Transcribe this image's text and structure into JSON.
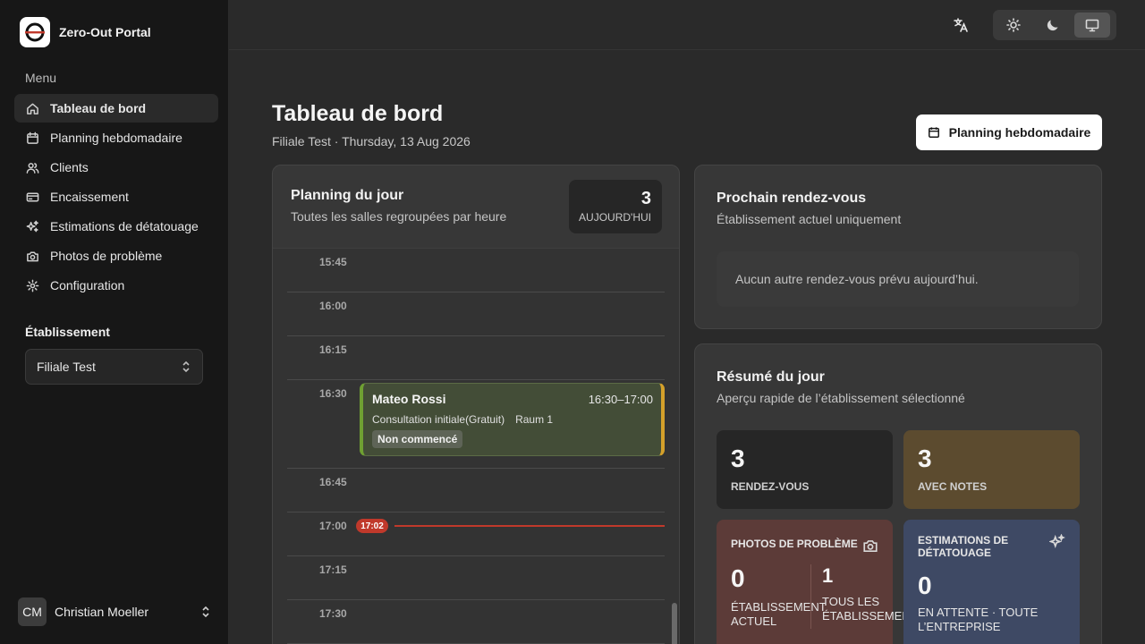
{
  "brand": {
    "title": "Zero-Out Portal"
  },
  "sidebar": {
    "menu_label": "Menu",
    "items": [
      {
        "label": "Tableau de bord",
        "icon": "home-icon",
        "active": true
      },
      {
        "label": "Planning hebdomadaire",
        "icon": "calendar-icon"
      },
      {
        "label": "Clients",
        "icon": "users-icon"
      },
      {
        "label": "Encaissement",
        "icon": "credit-card-icon"
      },
      {
        "label": "Estimations de détatouage",
        "icon": "sparkles-icon"
      },
      {
        "label": "Photos de problème",
        "icon": "camera-icon"
      },
      {
        "label": "Configuration",
        "icon": "gear-icon"
      }
    ],
    "establishment_label": "Établissement",
    "establishment_value": "Filiale Test"
  },
  "user": {
    "initials": "CM",
    "name": "Christian Moeller"
  },
  "topbar": {
    "translate_icon": "translate-icon",
    "themes": [
      "sun-icon",
      "moon-icon",
      "monitor-icon"
    ],
    "active_theme": "monitor-icon"
  },
  "header": {
    "title": "Tableau de bord",
    "subtitle": "Filiale Test · Thursday, 13 Aug 2026",
    "week_button": "Planning hebdomadaire"
  },
  "planning": {
    "title": "Planning du jour",
    "subtitle": "Toutes les salles regroupées par heure",
    "today_count": "3",
    "today_label": "Aujourd'hui",
    "slots": [
      "15:45",
      "16:00",
      "16:15",
      "16:30",
      "16:45",
      "17:00",
      "17:15",
      "17:30"
    ],
    "appointment": {
      "name": "Mateo Rossi",
      "time": "16:30–17:00",
      "type": "Consultation initiale(Gratuit)",
      "room": "Raum 1",
      "status": "Non commencé"
    },
    "now": "17:02"
  },
  "next": {
    "title": "Prochain rendez-vous",
    "subtitle": "Établissement actuel uniquement",
    "empty": "Aucun autre rendez-vous prévu aujourd’hui."
  },
  "summary": {
    "title": "Résumé du jour",
    "subtitle": "Aperçu rapide de l’établissement sélectionné",
    "appointments": {
      "value": "3",
      "label": "Rendez-vous"
    },
    "notes": {
      "value": "3",
      "label": "Avec notes"
    },
    "photos": {
      "title": "Photos de problème",
      "current_value": "0",
      "current_label": "Établissement actuel",
      "all_value": "1",
      "all_label": "Tous les établissements"
    },
    "estimates": {
      "title": "Estimations de détatouage",
      "value": "0",
      "label": "En attente · Toute l’entreprise"
    }
  },
  "colors": {
    "accent_green": "#6fa032",
    "accent_amber": "#d4a02a",
    "now_red": "#c0392b"
  }
}
